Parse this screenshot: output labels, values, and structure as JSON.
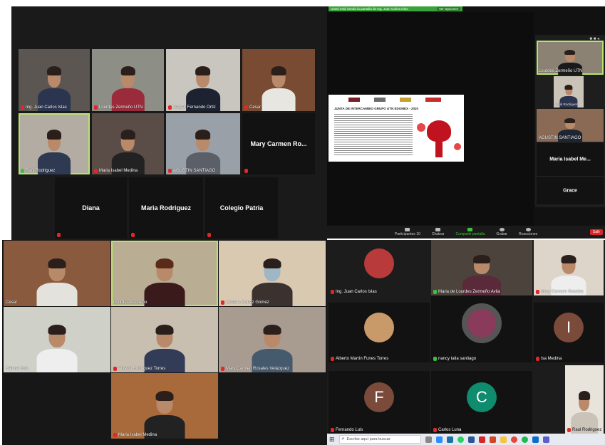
{
  "q1": {
    "tiles": [
      {
        "name": "Ing. Juan Carlos Islas",
        "muted": true
      },
      {
        "name": "Lourdes Zermeño UTN",
        "muted": true
      },
      {
        "name": "Jasper Fernando Ortiz",
        "muted": true
      },
      {
        "name": "Cesar",
        "muted": true
      },
      {
        "name": "Raúl Rodriguez",
        "muted": false
      },
      {
        "name": "Maria Isabel Medina",
        "muted": true
      },
      {
        "name": "AGUSTIN SANTIAGO",
        "muted": true
      },
      {
        "big": "Mary Carmen Ro..."
      },
      {
        "big": "Diana"
      },
      {
        "big": "Maria Rodriguez"
      },
      {
        "big": "Colegio Patria"
      }
    ]
  },
  "q2": {
    "share_banner": "Usted está viendo la pantalla de Ing. Juan Carlos Islas",
    "view_options": "Ver Opciones",
    "slide_title": "JUNTA DE INTERCAMBIO GRUPO UTN EDOMEX - 2020",
    "side": [
      {
        "name": "Lourdes Zermeño UTN"
      },
      {
        "name": "Raúl Rodriguez"
      },
      {
        "name": "AGUSTIN SANTIAGO"
      },
      {
        "big": "Maria Isabel Me..."
      },
      {
        "big": "Grace"
      }
    ],
    "toolbar": [
      {
        "label": "Participantes",
        "count": "10"
      },
      {
        "label": "Chatear"
      },
      {
        "label": "Compartir pantalla"
      },
      {
        "label": "Grabar"
      },
      {
        "label": "Reacciones"
      }
    ],
    "leave": "Salir"
  },
  "q3": {
    "tiles": [
      {
        "name": "Cesar"
      },
      {
        "name": "Lourdes Zermeño"
      },
      {
        "name": "Cristina Cortez Gomez"
      },
      {
        "name": "Fátima Ruiz"
      },
      {
        "name": "Alfredo Rodriguez Torres"
      },
      {
        "name": "Mary Carmen Rosales Velázquez"
      },
      {
        "name": "Maria Isabel Medina"
      }
    ]
  },
  "q4": {
    "tiles": [
      {
        "name": "Ing. Juan Carlos Islas"
      },
      {
        "name": "Maria de Lourdes Zermeño Avila"
      },
      {
        "name": "Mary Carmen Rosales"
      },
      {
        "name": "Alberto Martín Funes Torres"
      },
      {
        "name": "nancy talia santiago"
      },
      {
        "name": "Isa Medina",
        "letter": "I"
      },
      {
        "name": "Fernando Luis",
        "letter": "F"
      },
      {
        "name": "Carlos Luna",
        "letter": "C"
      },
      {
        "name": "Raul Rodriguez"
      }
    ],
    "search_placeholder": "Escribe aquí para buscar",
    "colors": {
      "brown": "#7a4a3a",
      "teal": "#0f8b6e"
    }
  }
}
